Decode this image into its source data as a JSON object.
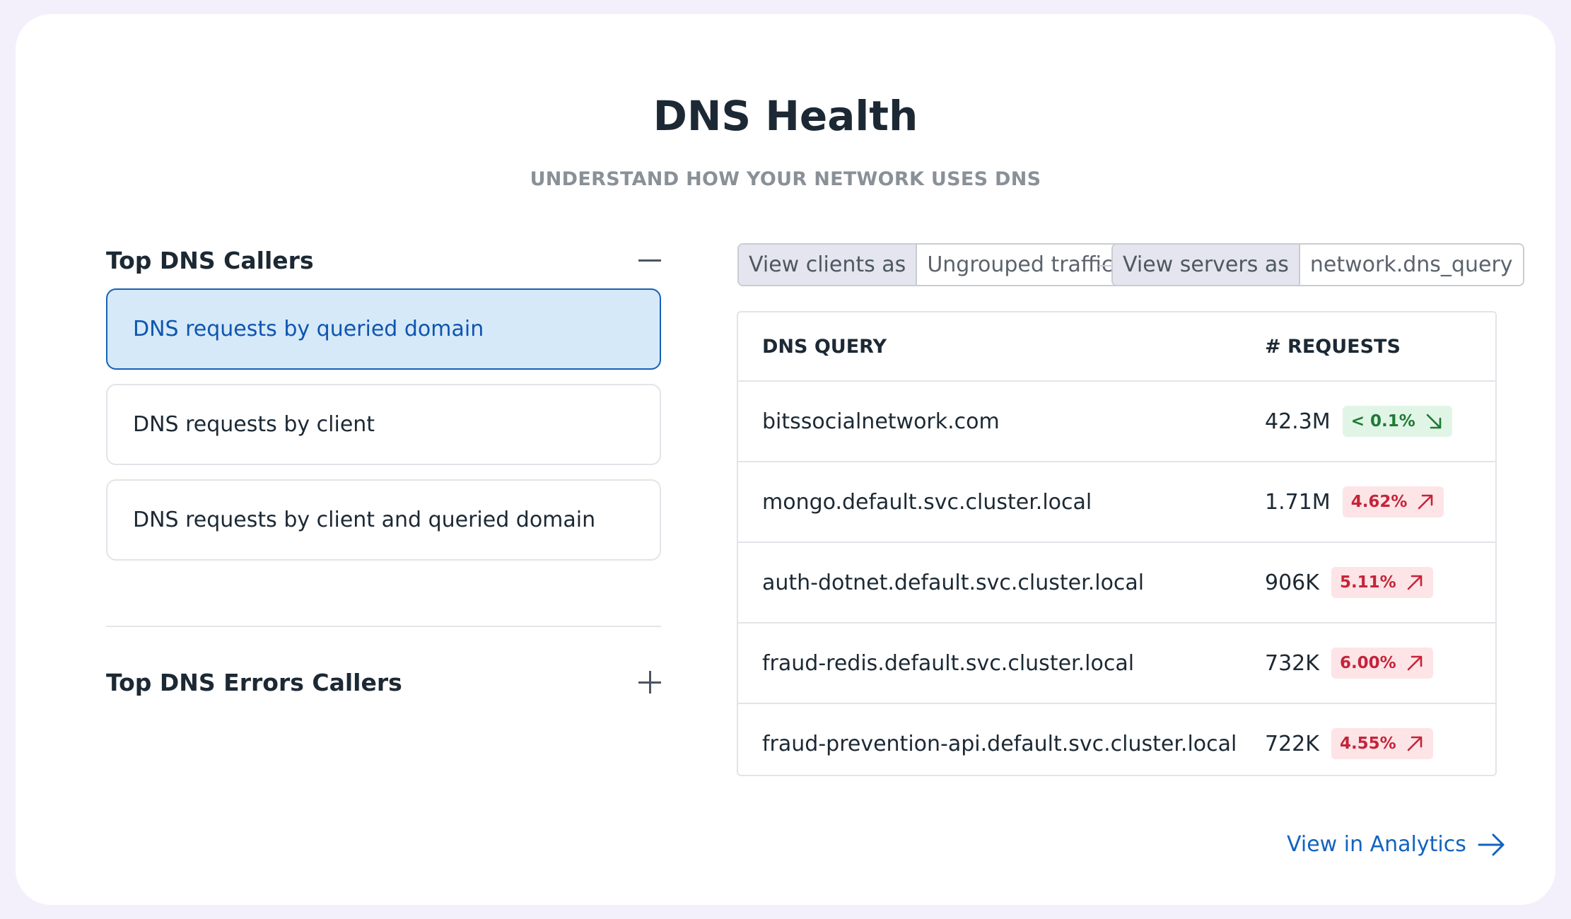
{
  "header": {
    "title": "DNS Health",
    "subtitle": "UNDERSTAND HOW YOUR NETWORK USES DNS"
  },
  "left_panel": {
    "section1": {
      "title": "Top DNS Callers",
      "toggle_icon": "minus-icon",
      "options": [
        {
          "label": "DNS requests by queried domain",
          "selected": true
        },
        {
          "label": "DNS requests by client",
          "selected": false
        },
        {
          "label": "DNS requests by client and queried domain",
          "selected": false
        }
      ]
    },
    "section2": {
      "title": "Top DNS Errors Callers",
      "toggle_icon": "plus-icon"
    }
  },
  "controls": {
    "clients": {
      "label": "View clients as",
      "value": "Ungrouped traffic"
    },
    "servers": {
      "label": "View servers as",
      "value": "network.dns_query"
    }
  },
  "table": {
    "headers": {
      "query": "DNS QUERY",
      "requests": "# REQUESTS"
    },
    "rows": [
      {
        "query": "bitssocialnetwork.com",
        "requests": "42.3M",
        "change": "< 0.1%",
        "trend": "down"
      },
      {
        "query": "mongo.default.svc.cluster.local",
        "requests": "1.71M",
        "change": "4.62%",
        "trend": "up"
      },
      {
        "query": "auth-dotnet.default.svc.cluster.local",
        "requests": "906K",
        "change": "5.11%",
        "trend": "up"
      },
      {
        "query": "fraud-redis.default.svc.cluster.local",
        "requests": "732K",
        "change": "6.00%",
        "trend": "up"
      },
      {
        "query": "fraud-prevention-api.default.svc.cluster.local",
        "requests": "722K",
        "change": "4.55%",
        "trend": "up"
      }
    ]
  },
  "footer": {
    "link_label": "View in Analytics",
    "link_icon": "arrow-right-icon"
  },
  "colors": {
    "background": "#f3f0fc",
    "accent": "#1363be",
    "selected_bg": "#d5e9f8",
    "trend_up": "#c4243a",
    "trend_down": "#1e7a35"
  }
}
